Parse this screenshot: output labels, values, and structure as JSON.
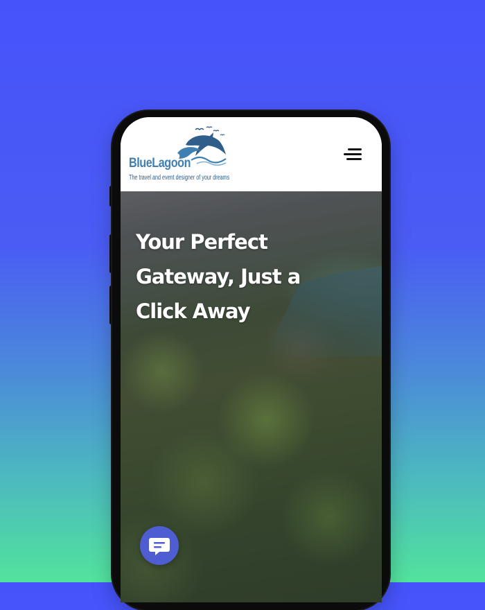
{
  "brand": {
    "name": "BlueLagoon",
    "tagline": "The travel and event designer of your dreams",
    "logo_icon": "dolphins-logo"
  },
  "header": {
    "menu_icon": "hamburger-menu-icon"
  },
  "hero": {
    "title": "Your Perfect Gateway, Just a Click Away"
  },
  "chat": {
    "icon": "chat-bubble-icon"
  },
  "colors": {
    "background_top": "#4653fb",
    "background_bottom": "#52e39d",
    "logo_blue": "#3f7fb2",
    "chat_button": "#4f5dd2"
  }
}
